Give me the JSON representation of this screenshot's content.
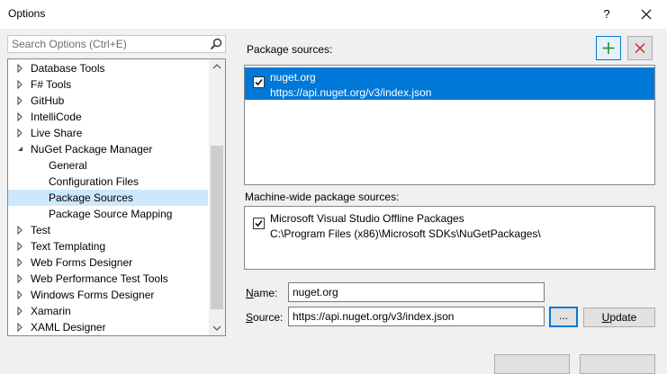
{
  "window": {
    "title": "Options",
    "help_label": "?",
    "close_icon": "close-icon"
  },
  "search": {
    "placeholder": "Search Options (Ctrl+E)",
    "value": "",
    "icon": "search-icon"
  },
  "tree": {
    "items": [
      {
        "label": "Database Tools",
        "level": 0,
        "expander": "collapsed",
        "selected": false
      },
      {
        "label": "F# Tools",
        "level": 0,
        "expander": "collapsed",
        "selected": false
      },
      {
        "label": "GitHub",
        "level": 0,
        "expander": "collapsed",
        "selected": false
      },
      {
        "label": "IntelliCode",
        "level": 0,
        "expander": "collapsed",
        "selected": false
      },
      {
        "label": "Live Share",
        "level": 0,
        "expander": "collapsed",
        "selected": false
      },
      {
        "label": "NuGet Package Manager",
        "level": 0,
        "expander": "expanded",
        "selected": false
      },
      {
        "label": "General",
        "level": 1,
        "expander": "none",
        "selected": false
      },
      {
        "label": "Configuration Files",
        "level": 1,
        "expander": "none",
        "selected": false
      },
      {
        "label": "Package Sources",
        "level": 1,
        "expander": "none",
        "selected": true
      },
      {
        "label": "Package Source Mapping",
        "level": 1,
        "expander": "none",
        "selected": false
      },
      {
        "label": "Test",
        "level": 0,
        "expander": "collapsed",
        "selected": false
      },
      {
        "label": "Text Templating",
        "level": 0,
        "expander": "collapsed",
        "selected": false
      },
      {
        "label": "Web Forms Designer",
        "level": 0,
        "expander": "collapsed",
        "selected": false
      },
      {
        "label": "Web Performance Test Tools",
        "level": 0,
        "expander": "collapsed",
        "selected": false
      },
      {
        "label": "Windows Forms Designer",
        "level": 0,
        "expander": "collapsed",
        "selected": false
      },
      {
        "label": "Xamarin",
        "level": 0,
        "expander": "collapsed",
        "selected": false
      },
      {
        "label": "XAML Designer",
        "level": 0,
        "expander": "collapsed",
        "selected": false
      }
    ]
  },
  "package_sources": {
    "label": "Package sources:",
    "add_icon": "plus-icon",
    "remove_icon": "x-icon",
    "items": [
      {
        "name": "nuget.org",
        "url": "https://api.nuget.org/v3/index.json",
        "checked": true,
        "selected": true
      }
    ]
  },
  "machine_wide": {
    "label": "Machine-wide package sources:",
    "items": [
      {
        "name": "Microsoft Visual Studio Offline Packages",
        "url": "C:\\Program Files (x86)\\Microsoft SDKs\\NuGetPackages\\",
        "checked": true,
        "selected": false
      }
    ]
  },
  "form": {
    "name_label": "Name:",
    "name_underline": "N",
    "name_rest": "ame:",
    "name_value": "nuget.org",
    "source_label": "Source:",
    "source_underline": "S",
    "source_rest": "ource:",
    "source_value": "https://api.nuget.org/v3/index.json",
    "browse_label": "...",
    "update_label": "Update",
    "update_underline": "U",
    "update_rest": "pdate"
  },
  "colors": {
    "selection_blue": "#0078d7",
    "tree_selection": "#cce8ff",
    "add_green": "#2a8c3c",
    "remove_red": "#c42b1c"
  }
}
